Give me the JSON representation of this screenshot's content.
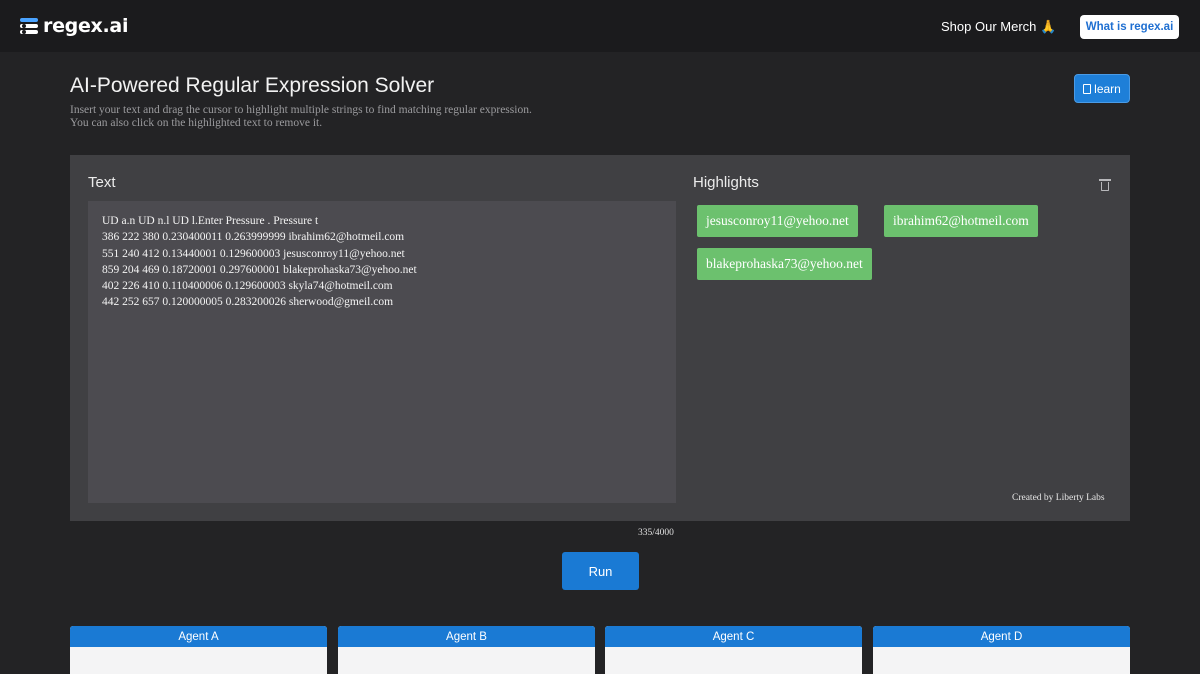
{
  "brand": {
    "name": "regex.ai"
  },
  "nav": {
    "merch_label": "Shop Our Merch 🙏",
    "what_is_label": "What is regex.ai"
  },
  "header": {
    "title": "AI-Powered Regular Expression Solver",
    "subtitle_line1": "Insert your text and drag the cursor to highlight multiple strings to find matching regular expression.",
    "subtitle_line2": "You can also click on the highlighted text to remove it.",
    "learn_label": "learn"
  },
  "editor": {
    "text_label": "Text",
    "lines": [
      "UD a.n UD n.l UD l.Enter Pressure . Pressure t",
      "386 222 380 0.230400011 0.263999999 ibrahim62@hotmeil.com",
      "551 240 412 0.13440001 0.129600003 jesusconroy11@yehoo.net",
      "859 204 469 0.18720001 0.297600001 blakeprohaska73@yehoo.net",
      "402 226 410 0.110400006 0.129600003 skyla74@hotmeil.com",
      "442 252 657 0.120000005 0.283200026 sherwood@gmeil.com"
    ],
    "char_count": "335/4000"
  },
  "highlights": {
    "label": "Highlights",
    "items": [
      "jesusconroy11@yehoo.net",
      "ibrahim62@hotmeil.com",
      "blakeprohaska73@yehoo.net"
    ],
    "credit": "Created by Liberty Labs"
  },
  "run_label": "Run",
  "agents": [
    "Agent A",
    "Agent B",
    "Agent C",
    "Agent D"
  ],
  "colors": {
    "background": "#232325",
    "topbar": "#1b1b1d",
    "panel": "#404043",
    "text_area": "#4c4b50",
    "accent_blue": "#1a7ad4",
    "highlight_green": "#6cc16e"
  },
  "icons": [
    "regex-logo-icon",
    "book-icon",
    "trash-icon"
  ]
}
